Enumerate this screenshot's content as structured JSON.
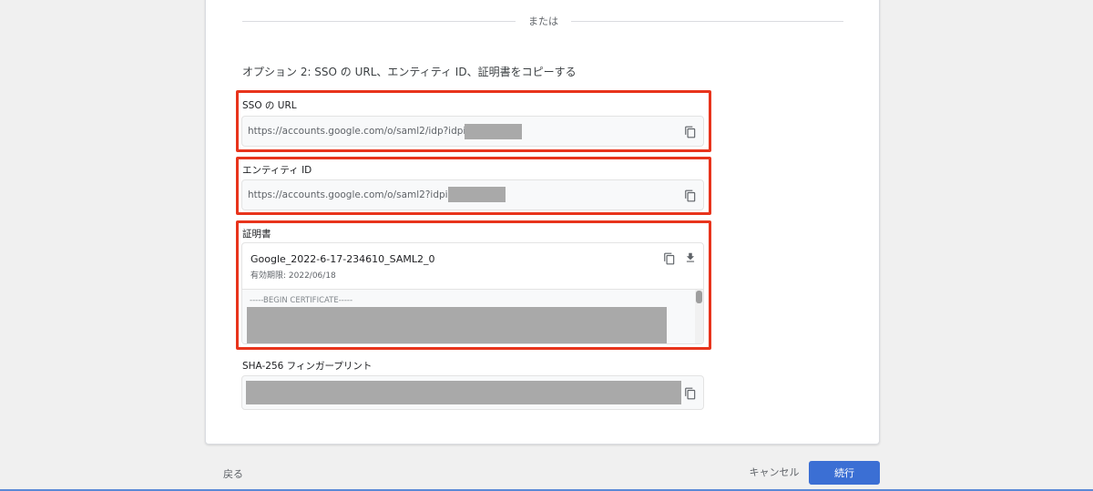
{
  "divider_text": "または",
  "option_title": "オプション 2: SSO の URL、エンティティ ID、証明書をコピーする",
  "sso": {
    "label": "SSO の URL",
    "value": "https://accounts.google.com/o/saml2/idp?idpid="
  },
  "entity": {
    "label": "エンティティ ID",
    "value": "https://accounts.google.com/o/saml2?idpid="
  },
  "certificate": {
    "label": "証明書",
    "name": "Google_2022-6-17-234610_SAML2_0",
    "expiry": "有効期限: 2022/06/18",
    "begin": "-----BEGIN CERTIFICATE-----"
  },
  "fingerprint": {
    "label": "SHA-256 フィンガープリント"
  },
  "footer": {
    "back": "戻る",
    "cancel": "キャンセル",
    "continue": "続行"
  },
  "colors": {
    "highlight_border": "#e8341c",
    "primary_button": "#3b6fd4",
    "redaction": "#a9a9a9"
  },
  "icons": {
    "copy": "copy-icon",
    "download": "download-icon"
  }
}
